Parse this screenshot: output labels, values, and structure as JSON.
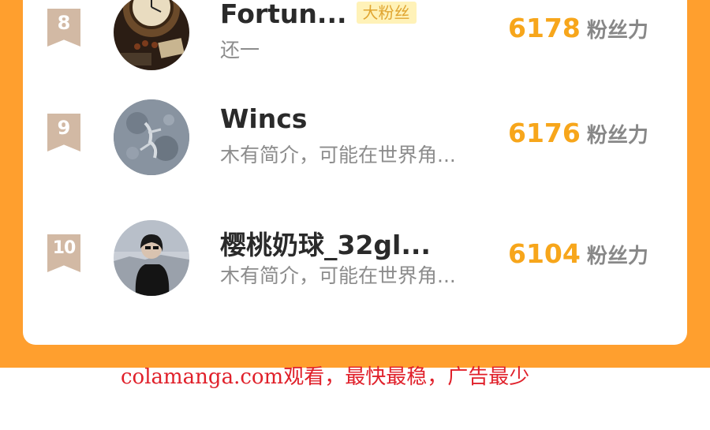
{
  "ranking": {
    "items": [
      {
        "rank": "8",
        "name": "Fortun...",
        "badge": "大粉丝",
        "bio": "还一",
        "score": "6178",
        "score_unit": "粉丝力",
        "avatar_icon": "clock-photo"
      },
      {
        "rank": "9",
        "name": "Wincs",
        "bio": "木有简介，可能在世界角...",
        "score": "6176",
        "score_unit": "粉丝力",
        "avatar_icon": "moon-photo"
      },
      {
        "rank": "10",
        "name": "樱桃奶球_32gl...",
        "bio": "木有简介，可能在世界角...",
        "score": "6104",
        "score_unit": "粉丝力",
        "avatar_icon": "person-photo"
      }
    ]
  },
  "footer": {
    "watermark": "colamanga.com观看，最快最稳，广告最少"
  },
  "colors": {
    "background_orange": "#ff9f2e",
    "score_orange": "#f7a61b",
    "rank_ribbon": "#d2b9a4",
    "badge_bg": "#fff2b8",
    "watermark_red": "#e0202a"
  }
}
